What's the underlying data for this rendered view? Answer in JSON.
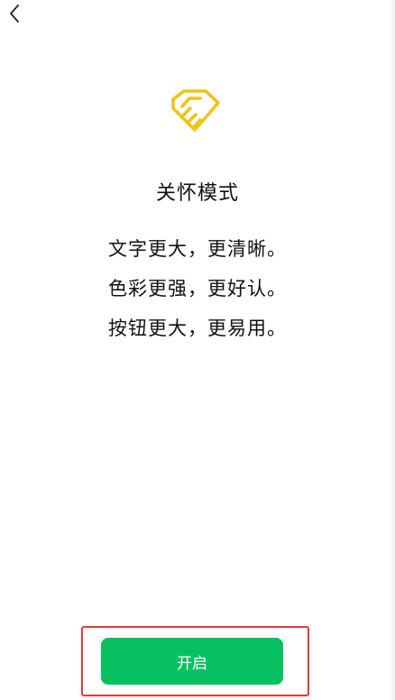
{
  "colors": {
    "accent": "#07c160",
    "icon": "#f2c21b",
    "highlight": "#e53935"
  },
  "header": {
    "back_icon": "chevron-left-icon"
  },
  "main": {
    "icon": "handshake-care-icon",
    "title": "关怀模式",
    "features": [
      "文字更大，更清晰。",
      "色彩更强，更好认。",
      "按钮更大，更易用。"
    ]
  },
  "footer": {
    "enable_label": "开启"
  }
}
